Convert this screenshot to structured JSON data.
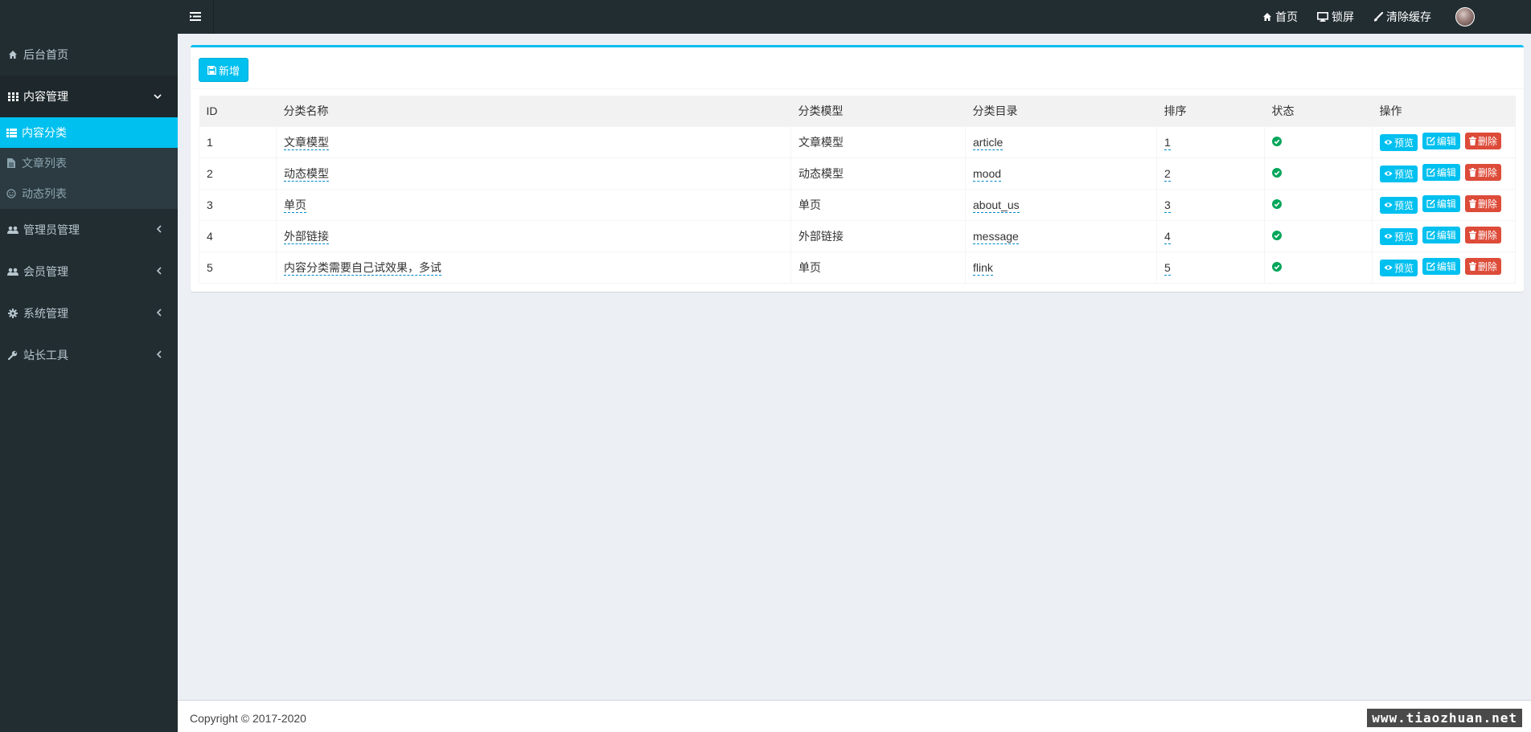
{
  "sidebar": {
    "home": "后台首页",
    "content_mgmt": "内容管理",
    "sub": {
      "category": "内容分类",
      "articles": "文章列表",
      "moods": "动态列表"
    },
    "admin_mgmt": "管理员管理",
    "member_mgmt": "会员管理",
    "system_mgmt": "系统管理",
    "tools": "站长工具"
  },
  "header": {
    "home": "首页",
    "lock": "锁屏",
    "clear_cache": "清除缓存"
  },
  "toolbar": {
    "add_label": "新增"
  },
  "table": {
    "headers": [
      "ID",
      "分类名称",
      "分类模型",
      "分类目录",
      "排序",
      "状态",
      "操作"
    ],
    "rows": [
      {
        "id": "1",
        "name": "文章模型",
        "model": "文章模型",
        "dir": "article",
        "sort": "1"
      },
      {
        "id": "2",
        "name": "动态模型",
        "model": "动态模型",
        "dir": "mood",
        "sort": "2"
      },
      {
        "id": "3",
        "name": "单页",
        "model": "单页",
        "dir": "about_us",
        "sort": "3"
      },
      {
        "id": "4",
        "name": "外部链接",
        "model": "外部链接",
        "dir": "message",
        "sort": "4"
      },
      {
        "id": "5",
        "name": "内容分类需要自己试效果，多试",
        "model": "单页",
        "dir": "flink",
        "sort": "5"
      }
    ],
    "actions": {
      "preview": "预览",
      "edit": "编辑",
      "delete": "删除"
    }
  },
  "footer": {
    "copyright": "Copyright © 2017-2020"
  },
  "watermark": "www.tiaozhuan.net",
  "colors": {
    "accent": "#00c0ef",
    "danger": "#dd4b39",
    "success": "#00a65a",
    "sidebar_bg": "#222d32"
  }
}
